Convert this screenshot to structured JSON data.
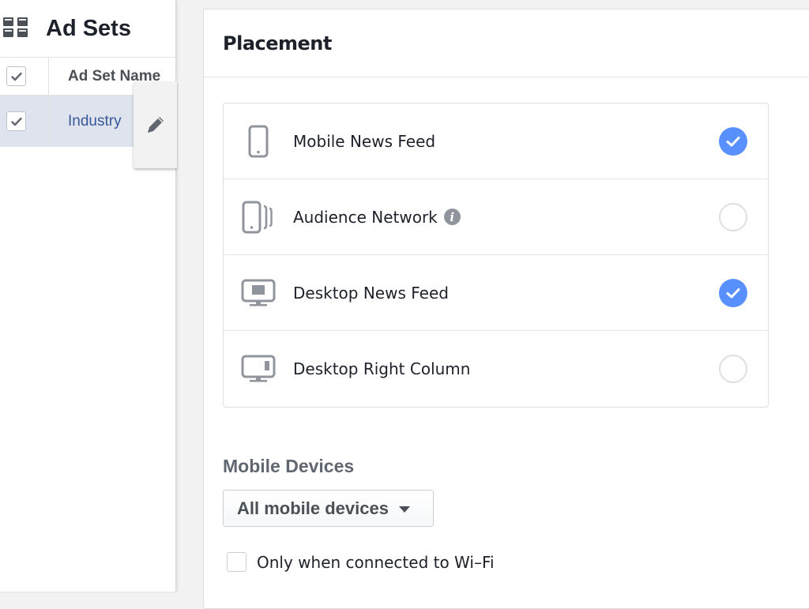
{
  "adsets": {
    "title": "Ad Sets",
    "icon": "grid-view-icon",
    "table": {
      "columns": [
        "Ad Set Name"
      ],
      "header_checked": true,
      "rows": [
        {
          "name": "Industry",
          "checked": true
        }
      ]
    },
    "edit_icon": "pencil-icon"
  },
  "placement": {
    "title": "Placement",
    "items": [
      {
        "label": "Mobile News Feed",
        "icon": "mobile-phone-icon",
        "selected": true,
        "info": false
      },
      {
        "label": "Audience Network",
        "icon": "audience-network-icon",
        "selected": false,
        "info": true
      },
      {
        "label": "Desktop News Feed",
        "icon": "desktop-news-feed-icon",
        "selected": true,
        "info": false
      },
      {
        "label": "Desktop Right Column",
        "icon": "desktop-right-column-icon",
        "selected": false,
        "info": false
      }
    ],
    "info_glyph": "i",
    "accent_color": "#5890ff"
  },
  "mobile_devices": {
    "title": "Mobile Devices",
    "dropdown_value": "All mobile devices",
    "wifi_only": {
      "label": "Only when connected to Wi–Fi",
      "checked": false
    }
  }
}
